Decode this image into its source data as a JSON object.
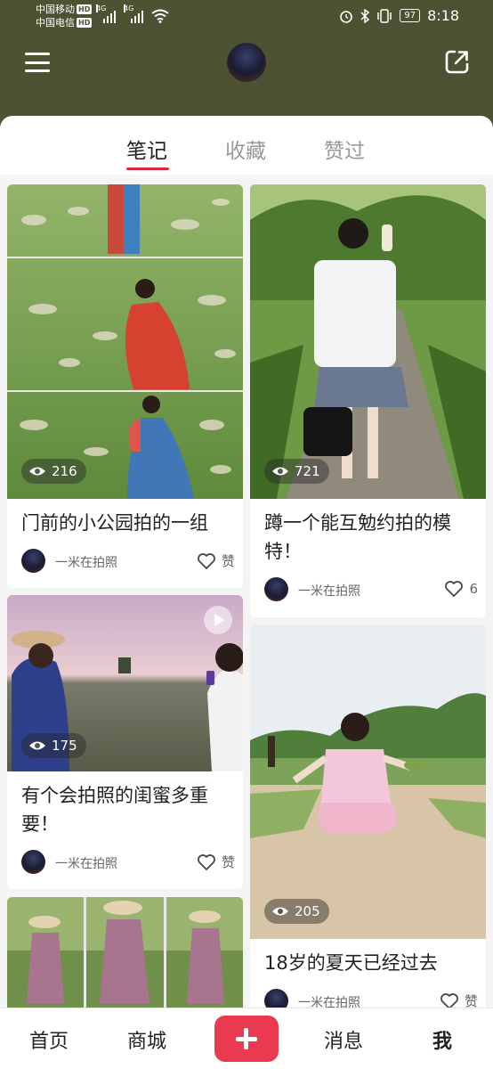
{
  "status_bar": {
    "carrier1": "中国移动",
    "carrier2": "中国电信",
    "hd": "HD",
    "net1": "4G",
    "net2": "4G",
    "battery": "97",
    "time": "8:18"
  },
  "tabs": [
    {
      "label": "笔记",
      "active": true
    },
    {
      "label": "收藏",
      "active": false
    },
    {
      "label": "赞过",
      "active": false
    }
  ],
  "posts": [
    {
      "title": "门前的小公园拍的一组",
      "views": "216",
      "author": "一米在拍照",
      "likes": "赞",
      "video": false
    },
    {
      "title": "蹲一个能互勉约拍的模特！",
      "views": "721",
      "author": "一米在拍照",
      "likes": "6",
      "video": false
    },
    {
      "title": "有个会拍照的闺蜜多重要！",
      "views": "175",
      "author": "一米在拍照",
      "likes": "赞",
      "video": true
    },
    {
      "title": "18岁的夏天已经过去",
      "views": "205",
      "author": "一米在拍照",
      "likes": "赞",
      "video": false
    }
  ],
  "bottom_nav": {
    "home": "首页",
    "mall": "商城",
    "messages": "消息",
    "me": "我"
  },
  "colors": {
    "header_bg": "#4c5232",
    "accent": "#d8293e",
    "add_button": "#ea3a4f"
  }
}
